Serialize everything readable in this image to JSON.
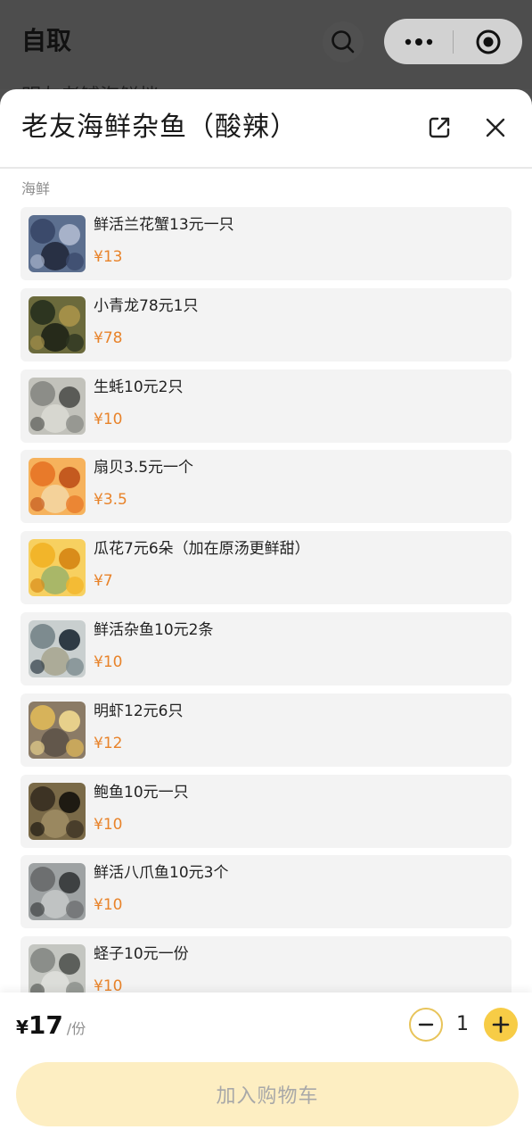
{
  "background_page": {
    "title": "自取",
    "peek_text": "明友老铺海鲜档"
  },
  "capsule": {
    "more_icon": "more-dots-icon",
    "close_icon": "target-close-icon"
  },
  "sheet": {
    "title": "老友海鲜杂鱼（酸辣）",
    "share_icon": "share-external-icon",
    "close_icon": "close-icon"
  },
  "section": {
    "label": "海鲜"
  },
  "items": [
    {
      "name": "鲜活兰花蟹13元一只",
      "price": "¥13",
      "thumb": "crab-photo",
      "palette": [
        "#3b4a6b",
        "#5c6f8f",
        "#a7b2c9",
        "#1f2637"
      ]
    },
    {
      "name": "小青龙78元1只",
      "price": "¥78",
      "thumb": "lobster-photo",
      "palette": [
        "#2d3520",
        "#6b6a3c",
        "#a38f48",
        "#1a1f14"
      ]
    },
    {
      "name": "生蚝10元2只",
      "price": "¥10",
      "thumb": "oyster-photo",
      "palette": [
        "#8c8d88",
        "#c2c2bb",
        "#5a5b57",
        "#dadad3"
      ]
    },
    {
      "name": "扇贝3.5元一个",
      "price": "¥3.5",
      "thumb": "scallop-photo",
      "palette": [
        "#e87a2a",
        "#f6b25c",
        "#c45a1f",
        "#f3d7a5"
      ]
    },
    {
      "name": "瓜花7元6朵（加在原汤更鲜甜）",
      "price": "¥7",
      "thumb": "squash-flower-photo",
      "palette": [
        "#f2b52a",
        "#f7d060",
        "#d98c1a",
        "#9bb36a"
      ]
    },
    {
      "name": "鲜活杂鱼10元2条",
      "price": "¥10",
      "thumb": "mixed-fish-photo",
      "palette": [
        "#7d8b8f",
        "#c9cfcf",
        "#2e3a44",
        "#a7a58e"
      ]
    },
    {
      "name": "明虾12元6只",
      "price": "¥12",
      "thumb": "shrimp-photo",
      "palette": [
        "#d7b35a",
        "#8b7b66",
        "#e7d08b",
        "#5b5147"
      ]
    },
    {
      "name": "鲍鱼10元一只",
      "price": "¥10",
      "thumb": "abalone-photo",
      "palette": [
        "#3d3324",
        "#7a6a48",
        "#1e1a12",
        "#a08d65"
      ]
    },
    {
      "name": "鲜活八爪鱼10元3个",
      "price": "¥10",
      "thumb": "octopus-photo",
      "palette": [
        "#6d6f70",
        "#9ea2a3",
        "#3e4142",
        "#c6c9c9"
      ]
    },
    {
      "name": "蛏子10元一份",
      "price": "¥10",
      "thumb": "razor-clam-photo",
      "palette": [
        "#8b8e8a",
        "#c4c6c1",
        "#5c5f5b",
        "#e0e1dd"
      ]
    }
  ],
  "bottom_bar": {
    "currency": "¥",
    "price": "17",
    "unit": "/份",
    "quantity": "1",
    "minus_icon": "minus-icon",
    "plus_icon": "plus-icon",
    "add_to_cart_label": "加入购物车"
  },
  "colors": {
    "accent": "#f7cc46",
    "price_orange": "#e8832a",
    "cart_button_disabled": "#fdeec2"
  }
}
